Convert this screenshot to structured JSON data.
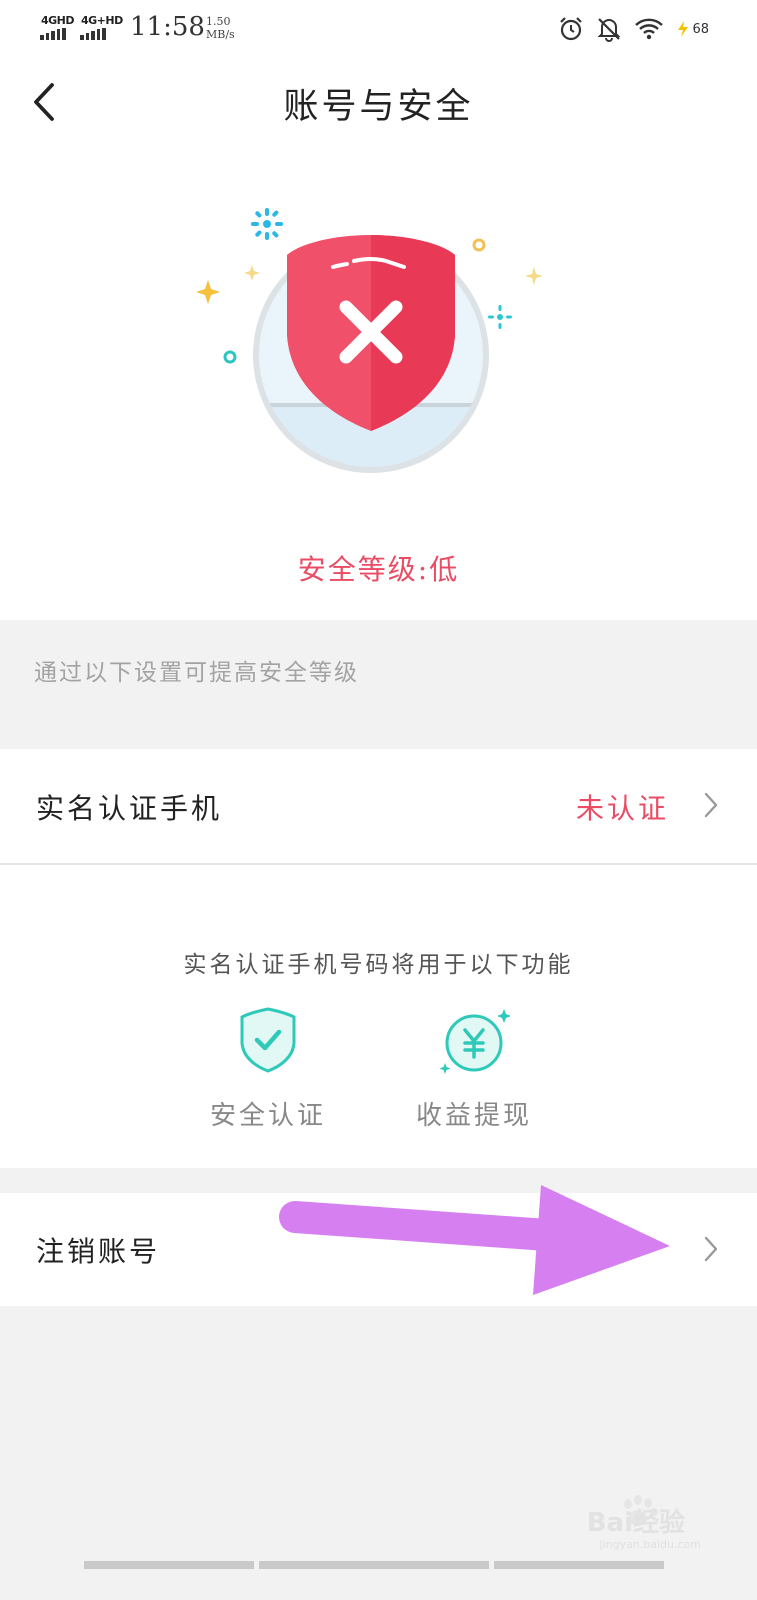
{
  "status_bar": {
    "signal1": "4GHD",
    "signal2": "4G+HD",
    "time": "11:58",
    "speed_value": "1.50",
    "speed_unit": "MB/s",
    "battery": "68",
    "icons": [
      "alarm-icon",
      "mute-icon",
      "wifi-icon",
      "battery-icon"
    ]
  },
  "nav": {
    "title": "账号与安全",
    "back_icon": "back-arrow-icon"
  },
  "security": {
    "level_text": "安全等级:低",
    "hint": "通过以下设置可提高安全等级",
    "level_color": "#e94c64"
  },
  "rows": {
    "real_name": {
      "label": "实名认证手机",
      "value": "未认证"
    },
    "cancel_account": {
      "label": "注销账号"
    }
  },
  "info": {
    "title": "实名认证手机号码将用于以下功能",
    "features": [
      {
        "label": "安全认证",
        "icon": "shield-check-icon"
      },
      {
        "label": "收益提现",
        "icon": "yuan-coin-icon"
      }
    ]
  },
  "watermark": {
    "text": "Bai经验",
    "sub": "jingyan.baidu.com"
  },
  "colors": {
    "accent_red": "#e94c64",
    "teal": "#2ec9b8",
    "annotation_purple": "#d57ff1"
  }
}
